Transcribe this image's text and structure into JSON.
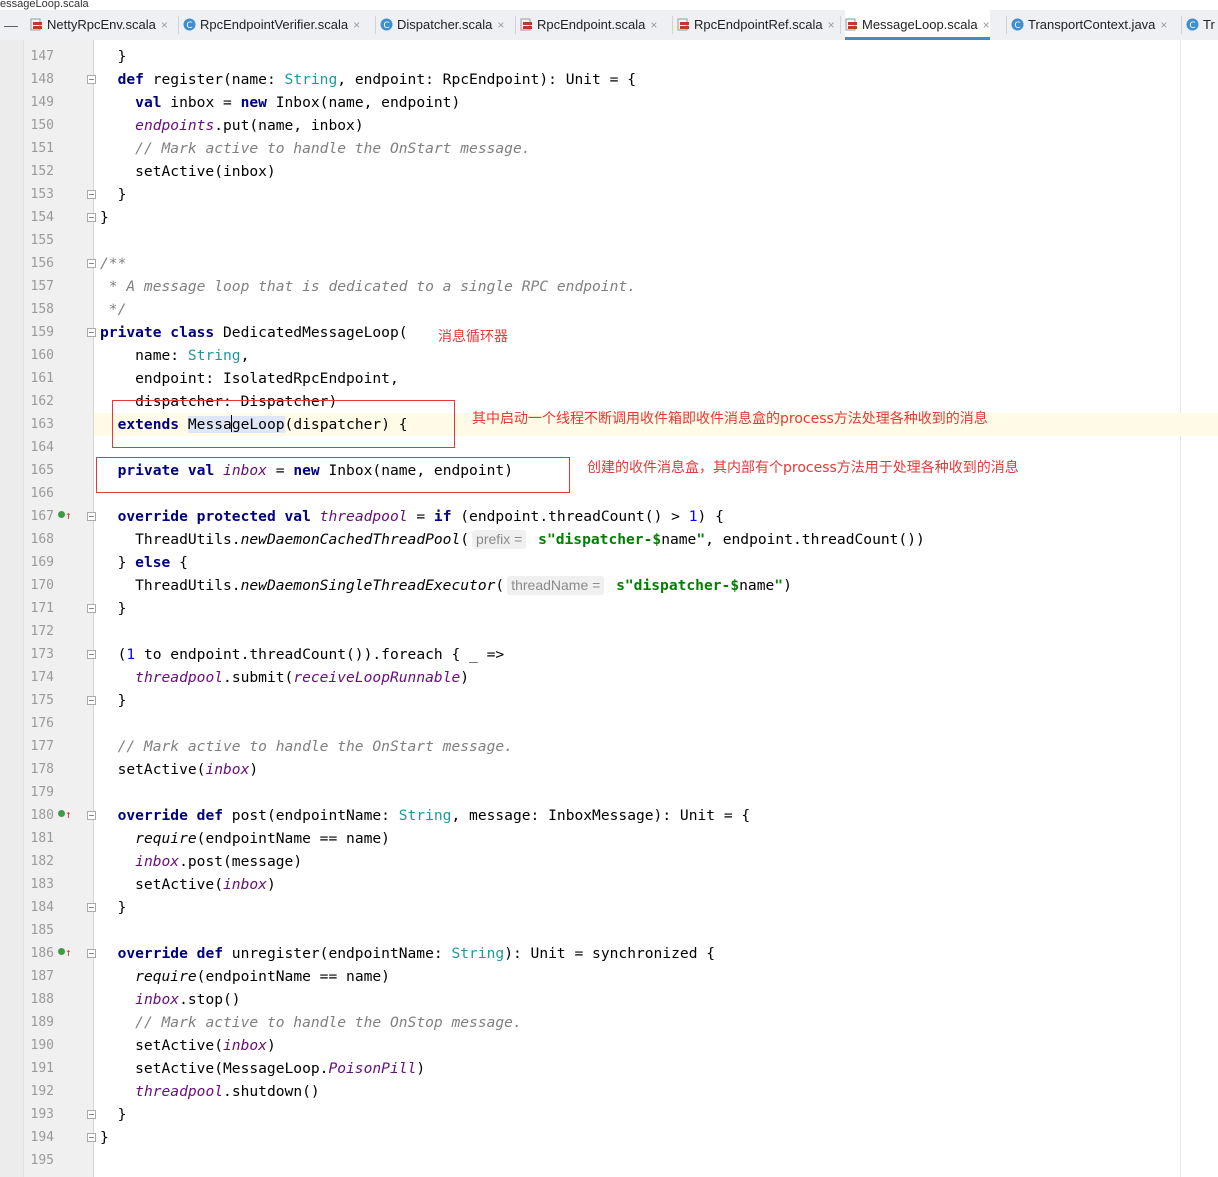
{
  "window_title": "essageLoop.scala",
  "tabs": [
    {
      "label": "NettyRpcEnv.scala",
      "icon": "scala-file-icon",
      "active": false
    },
    {
      "label": "RpcEndpointVerifier.scala",
      "icon": "class-file-icon",
      "active": false
    },
    {
      "label": "Dispatcher.scala",
      "icon": "class-file-icon",
      "active": false
    },
    {
      "label": "RpcEndpoint.scala",
      "icon": "scala-file-icon",
      "active": false
    },
    {
      "label": "RpcEndpointRef.scala",
      "icon": "scala-file-icon",
      "active": false
    },
    {
      "label": "MessageLoop.scala",
      "icon": "scala-file-icon",
      "active": true
    },
    {
      "label": "TransportContext.java",
      "icon": "class-file-icon",
      "active": false
    },
    {
      "label": "Tr",
      "icon": "class-file-icon",
      "active": false
    }
  ],
  "colors": {
    "accent": "#4a86c8",
    "keyword": "#000080",
    "type": "#20999d",
    "comment": "#808080",
    "field": "#660e7a",
    "string": "#008000",
    "annotation": "#e23a3a"
  },
  "code_lines": [
    {
      "n": "147",
      "html": "  }"
    },
    {
      "n": "148",
      "html": "  <span class='kw'>def</span> register(name: <span class='ty'>String</span>, endpoint: RpcEndpoint): Unit = {"
    },
    {
      "n": "149",
      "html": "    <span class='kw'>val</span> inbox = <span class='kw'>new</span> Inbox(name, endpoint)"
    },
    {
      "n": "150",
      "html": "    <span class='fd'>endpoints</span>.put(name, inbox)"
    },
    {
      "n": "151",
      "html": "    <span class='cm'>// Mark active to handle the OnStart message.</span>"
    },
    {
      "n": "152",
      "html": "    setActive(inbox)"
    },
    {
      "n": "153",
      "html": "  }"
    },
    {
      "n": "154",
      "html": "}"
    },
    {
      "n": "155",
      "html": ""
    },
    {
      "n": "156",
      "html": "<span class='cm'>/**</span>"
    },
    {
      "n": "157",
      "html": "<span class='cm'> * A message loop that is dedicated to a single RPC endpoint.</span>"
    },
    {
      "n": "158",
      "html": "<span class='cm'> */</span>"
    },
    {
      "n": "159",
      "html": "<span class='kw'>private class</span> DedicatedMessageLoop("
    },
    {
      "n": "160",
      "html": "    name: <span class='ty'>String</span>,"
    },
    {
      "n": "161",
      "html": "    endpoint: IsolatedRpcEndpoint,"
    },
    {
      "n": "162",
      "html": "    dispatcher: Dispatcher)"
    },
    {
      "n": "163",
      "html": "  <span class='kw'>extends</span> <span class='hl'>Messa<span class='caret'></span>geLoop</span>(dispatcher) {"
    },
    {
      "n": "164",
      "html": ""
    },
    {
      "n": "165",
      "html": "  <span class='kw'>private val</span> <span class='fd'>inbox</span> = <span class='kw'>new</span> Inbox(name, endpoint)"
    },
    {
      "n": "166",
      "html": ""
    },
    {
      "n": "167",
      "html": "  <span class='kw'>override protected val</span> <span class='fd'>threadpool</span> = <span class='kw'>if</span> (endpoint.threadCount() &gt; <span class='nm'>1</span>) {"
    },
    {
      "n": "168",
      "html": "    ThreadUtils.<span class='mi'>newDaemonCachedThreadPool</span>(<span class='hint'>prefix =</span> <span class='st'>s\"dispatcher-</span><span class='st'>$</span>name<span class='st'>\"</span>, endpoint.threadCount())"
    },
    {
      "n": "169",
      "html": "  } <span class='kw'>else</span> {"
    },
    {
      "n": "170",
      "html": "    ThreadUtils.<span class='mi'>newDaemonSingleThreadExecutor</span>(<span class='hint'>threadName =</span> <span class='st'>s\"dispatcher-</span><span class='st'>$</span>name<span class='st'>\"</span>)"
    },
    {
      "n": "171",
      "html": "  }"
    },
    {
      "n": "172",
      "html": ""
    },
    {
      "n": "173",
      "html": "  (<span class='nm'>1</span> to endpoint.threadCount()).foreach { _ =&gt;"
    },
    {
      "n": "174",
      "html": "    <span class='fd'>threadpool</span>.submit(<span class='fd'>receiveLoopRunnable</span>)"
    },
    {
      "n": "175",
      "html": "  }"
    },
    {
      "n": "176",
      "html": ""
    },
    {
      "n": "177",
      "html": "  <span class='cm'>// Mark active to handle the OnStart message.</span>"
    },
    {
      "n": "178",
      "html": "  setActive(<span class='fd'>inbox</span>)"
    },
    {
      "n": "179",
      "html": ""
    },
    {
      "n": "180",
      "html": "  <span class='kw'>override def</span> post(endpointName: <span class='ty'>String</span>, message: InboxMessage): Unit = {"
    },
    {
      "n": "181",
      "html": "    <span class='mi'>require</span>(endpointName == name)"
    },
    {
      "n": "182",
      "html": "    <span class='fd'>inbox</span>.post(message)"
    },
    {
      "n": "183",
      "html": "    setActive(<span class='fd'>inbox</span>)"
    },
    {
      "n": "184",
      "html": "  }"
    },
    {
      "n": "185",
      "html": ""
    },
    {
      "n": "186",
      "html": "  <span class='kw'>override def</span> unregister(endpointName: <span class='ty'>String</span>): Unit = synchronized {"
    },
    {
      "n": "187",
      "html": "    <span class='mi'>require</span>(endpointName == name)"
    },
    {
      "n": "188",
      "html": "    <span class='fd'>inbox</span>.stop()"
    },
    {
      "n": "189",
      "html": "    <span class='cm'>// Mark active to handle the OnStop message.</span>"
    },
    {
      "n": "190",
      "html": "    setActive(<span class='fd'>inbox</span>)"
    },
    {
      "n": "191",
      "html": "    setActive(MessageLoop.<span class='fi mi'>PoisonPill</span>)"
    },
    {
      "n": "192",
      "html": "    <span class='fd'>threadpool</span>.shutdown()"
    },
    {
      "n": "193",
      "html": "  }"
    },
    {
      "n": "194",
      "html": "}"
    },
    {
      "n": "195",
      "html": ""
    }
  ],
  "annotations": {
    "a1": "消息循环器",
    "a2": "其中启动一个线程不断调用收件箱即收件消息盒的process方法处理各种收到的消息",
    "a3": "创建的收件消息盒，其内部有个process方法用于处理各种收到的消息"
  }
}
